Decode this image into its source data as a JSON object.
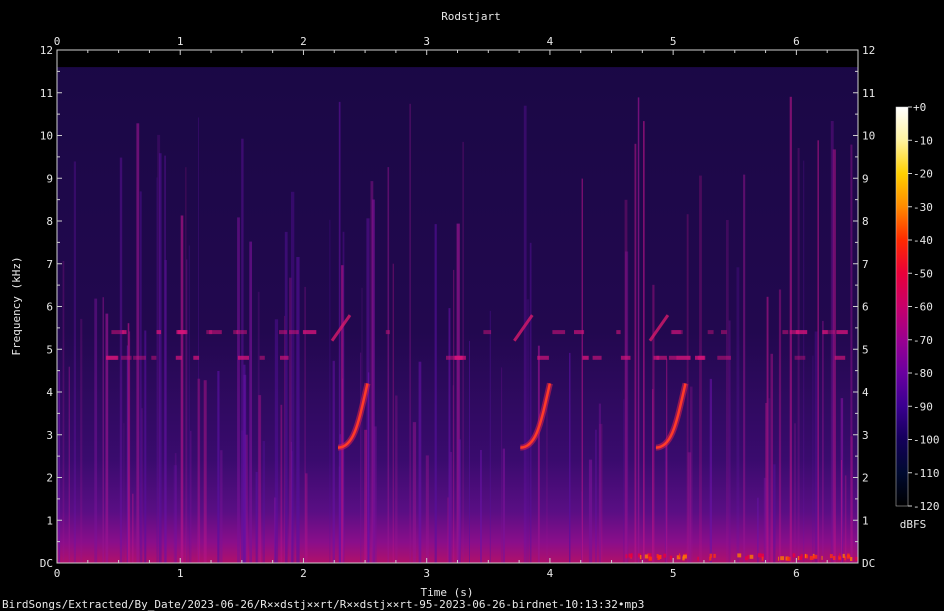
{
  "chart_data": {
    "type": "heatmap",
    "title": "Rodstjart",
    "xlabel": "Time (s)",
    "ylabel": "Frequency (kHz)",
    "xlim": [
      0,
      6.5
    ],
    "ylim": [
      0,
      12
    ],
    "x_ticks": [
      "0",
      "1",
      "2",
      "3",
      "4",
      "5",
      "6"
    ],
    "y_ticks": [
      "DC",
      "1",
      "2",
      "3",
      "4",
      "5",
      "6",
      "7",
      "8",
      "9",
      "10",
      "11",
      "12"
    ],
    "colorbar": {
      "label": "dBFS",
      "range": [
        -120,
        0
      ],
      "ticks": [
        "+0",
        "-10",
        "-20",
        "-30",
        "-40",
        "-50",
        "-60",
        "-70",
        "-80",
        "-90",
        "-100",
        "-110",
        "-120"
      ],
      "colors": [
        "#ffffff",
        "#fff3a0",
        "#ffd000",
        "#ff8a00",
        "#ff2a00",
        "#e8003a",
        "#c8006a",
        "#9a0090",
        "#6a00a0",
        "#3a0090",
        "#14005a",
        "#000a30",
        "#000000"
      ]
    },
    "background_noise_top_khz": 11.6,
    "calls": [
      {
        "t_start": 2.28,
        "t_end": 2.52,
        "f_start_khz": 2.7,
        "f_end_khz": 4.2
      },
      {
        "t_start": 3.76,
        "t_end": 4.0,
        "f_start_khz": 2.7,
        "f_end_khz": 4.2
      },
      {
        "t_start": 4.86,
        "t_end": 5.1,
        "f_start_khz": 2.7,
        "f_end_khz": 4.2
      }
    ],
    "tonal_bands_khz": [
      4.8,
      5.4
    ]
  },
  "footer": {
    "file_path": "BirdSongs/Extracted/By_Date/2023-06-26/R××dstj××rt/R××dstj××rt-95-2023-06-26-birdnet-10:13:32•mp3"
  }
}
